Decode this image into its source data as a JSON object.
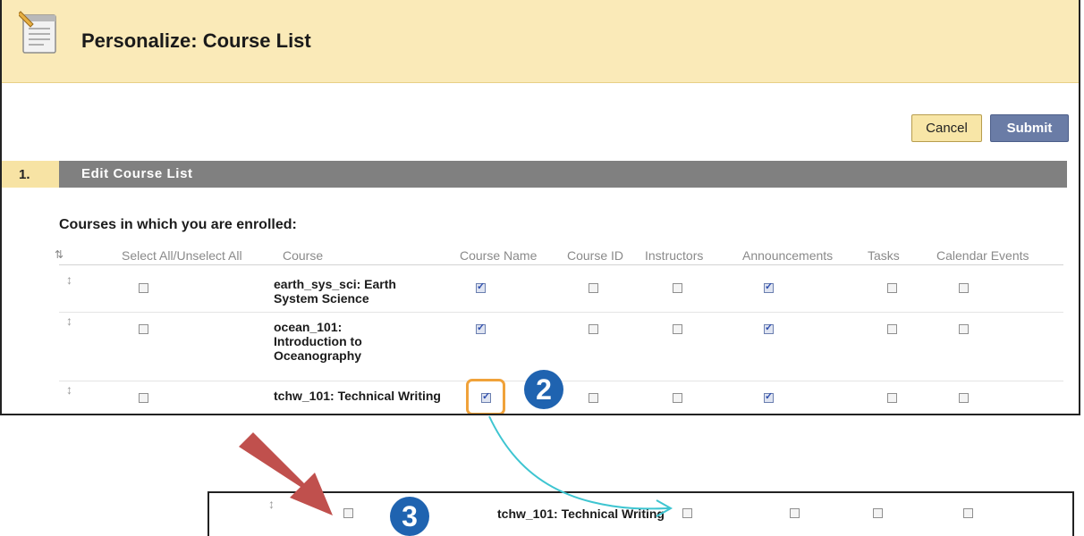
{
  "header": {
    "title": "Personalize: Course List",
    "icon": "notepad-icon"
  },
  "actions": {
    "cancel": "Cancel",
    "submit": "Submit"
  },
  "step": {
    "number": "1.",
    "title": "Edit Course List"
  },
  "section": {
    "heading": "Courses in which you are enrolled:"
  },
  "table": {
    "headers": [
      "Select All/Unselect All",
      "Course",
      "Course Name",
      "Course ID",
      "Instructors",
      "Announcements",
      "Tasks",
      "Calendar Events"
    ],
    "rows": [
      {
        "course": "earth_sys_sci: Earth System Science",
        "select": false,
        "course_name": true,
        "course_id": false,
        "instructors": false,
        "announcements": true,
        "tasks": false,
        "calendar_events": false
      },
      {
        "course": "ocean_101: Introduction to Oceanography",
        "select": false,
        "course_name": true,
        "course_id": false,
        "instructors": false,
        "announcements": true,
        "tasks": false,
        "calendar_events": false
      },
      {
        "course": "tchw_101: Technical Writing",
        "select": false,
        "course_name": true,
        "course_id": false,
        "instructors": false,
        "announcements": true,
        "tasks": false,
        "calendar_events": false
      }
    ]
  },
  "callouts": {
    "step2": "2",
    "step3": "3"
  },
  "bottom_row": {
    "course": "tchw_101: Technical Writing",
    "select": false,
    "course_id": false,
    "instructors": false,
    "announcements": false,
    "tasks": false
  },
  "colors": {
    "header_bg": "#faeab8",
    "step_bar": "#808080",
    "badge": "#1f63b0",
    "highlight": "#f0a23a",
    "arrow": "#c0504d",
    "connector": "#3ec5d1",
    "submit": "#6a7ca6"
  }
}
